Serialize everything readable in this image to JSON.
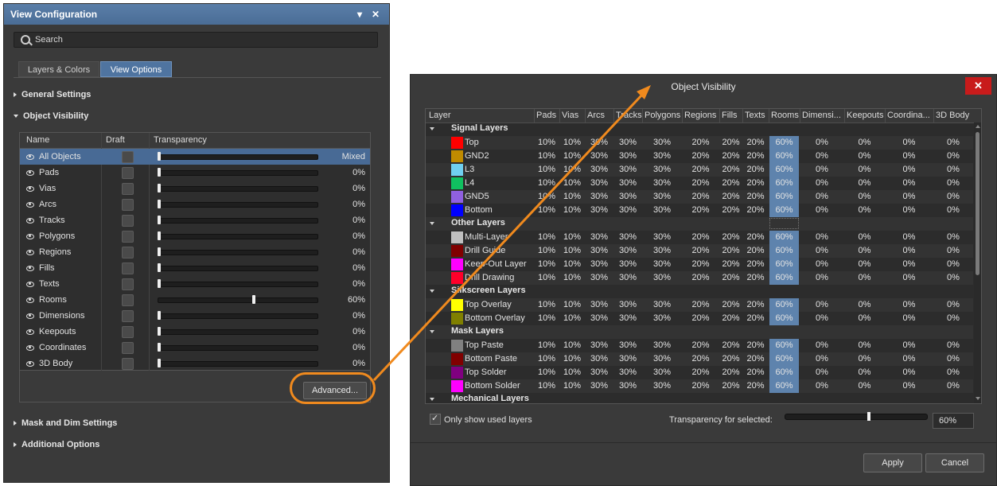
{
  "view_config": {
    "title": "View Configuration",
    "menu_glyph": "▾",
    "close_glyph": "✕",
    "search_placeholder": "Search",
    "tabs": [
      {
        "label": "Layers & Colors"
      },
      {
        "label": "View Options"
      }
    ],
    "active_tab": 1,
    "sections": {
      "general": "General Settings",
      "object_visibility": "Object Visibility",
      "mask_dim": "Mask and Dim Settings",
      "additional": "Additional Options"
    },
    "table_headers": {
      "name": "Name",
      "draft": "Draft",
      "transparency": "Transparency"
    },
    "objects": [
      {
        "name": "All Objects",
        "value": "Mixed",
        "level": 0
      },
      {
        "name": "Pads",
        "value": "0%",
        "level": 0
      },
      {
        "name": "Vias",
        "value": "0%",
        "level": 0
      },
      {
        "name": "Arcs",
        "value": "0%",
        "level": 0
      },
      {
        "name": "Tracks",
        "value": "0%",
        "level": 0
      },
      {
        "name": "Polygons",
        "value": "0%",
        "level": 0
      },
      {
        "name": "Regions",
        "value": "0%",
        "level": 0
      },
      {
        "name": "Fills",
        "value": "0%",
        "level": 0
      },
      {
        "name": "Texts",
        "value": "0%",
        "level": 0
      },
      {
        "name": "Rooms",
        "value": "60%",
        "level": 0.6
      },
      {
        "name": "Dimensions",
        "value": "0%",
        "level": 0
      },
      {
        "name": "Keepouts",
        "value": "0%",
        "level": 0
      },
      {
        "name": "Coordinates",
        "value": "0%",
        "level": 0
      },
      {
        "name": "3D Body",
        "value": "0%",
        "level": 0
      }
    ],
    "advanced_button": "Advanced...",
    "callout_color": "#f08a1e"
  },
  "object_visibility_dialog": {
    "title": "Object Visibility",
    "close_glyph": "✕",
    "columns": [
      "Layer",
      "Pads",
      "Vias",
      "Arcs",
      "Tracks",
      "Polygons",
      "Regions",
      "Fills",
      "Texts",
      "Rooms",
      "Dimensi...",
      "Keepouts",
      "Coordina...",
      "3D Body"
    ],
    "rows": [
      {
        "group": "Signal Layers"
      },
      {
        "layer": "Top",
        "color": "#ff0000",
        "values": [
          "10%",
          "10%",
          "30%",
          "30%",
          "30%",
          "20%",
          "20%",
          "20%",
          "60%",
          "0%",
          "0%",
          "0%",
          "0%"
        ]
      },
      {
        "layer": "GND2",
        "color": "#c08b00",
        "values": [
          "10%",
          "10%",
          "30%",
          "30%",
          "30%",
          "20%",
          "20%",
          "20%",
          "60%",
          "0%",
          "0%",
          "0%",
          "0%"
        ]
      },
      {
        "layer": "L3",
        "color": "#70d0f0",
        "values": [
          "10%",
          "10%",
          "30%",
          "30%",
          "30%",
          "20%",
          "20%",
          "20%",
          "60%",
          "0%",
          "0%",
          "0%",
          "0%"
        ]
      },
      {
        "layer": "L4",
        "color": "#10c060",
        "values": [
          "10%",
          "10%",
          "30%",
          "30%",
          "30%",
          "20%",
          "20%",
          "20%",
          "60%",
          "0%",
          "0%",
          "0%",
          "0%"
        ]
      },
      {
        "layer": "GND5",
        "color": "#9060e0",
        "values": [
          "10%",
          "10%",
          "30%",
          "30%",
          "30%",
          "20%",
          "20%",
          "20%",
          "60%",
          "0%",
          "0%",
          "0%",
          "0%"
        ]
      },
      {
        "layer": "Bottom",
        "color": "#0000ff",
        "values": [
          "10%",
          "10%",
          "30%",
          "30%",
          "30%",
          "20%",
          "20%",
          "20%",
          "60%",
          "0%",
          "0%",
          "0%",
          "0%"
        ]
      },
      {
        "group": "Other Layers"
      },
      {
        "layer": "Multi-Layer",
        "color": "#c0c0c0",
        "values": [
          "10%",
          "10%",
          "30%",
          "30%",
          "30%",
          "20%",
          "20%",
          "20%",
          "60%",
          "0%",
          "0%",
          "0%",
          "0%"
        ]
      },
      {
        "layer": "Drill Guide",
        "color": "#800000",
        "values": [
          "10%",
          "10%",
          "30%",
          "30%",
          "30%",
          "20%",
          "20%",
          "20%",
          "60%",
          "0%",
          "0%",
          "0%",
          "0%"
        ]
      },
      {
        "layer": "Keep-Out Layer",
        "color": "#ff00ff",
        "values": [
          "10%",
          "10%",
          "30%",
          "30%",
          "30%",
          "20%",
          "20%",
          "20%",
          "60%",
          "0%",
          "0%",
          "0%",
          "0%"
        ]
      },
      {
        "layer": "Drill Drawing",
        "color": "#ff002a",
        "values": [
          "10%",
          "10%",
          "30%",
          "30%",
          "30%",
          "20%",
          "20%",
          "20%",
          "60%",
          "0%",
          "0%",
          "0%",
          "0%"
        ]
      },
      {
        "group": "Silkscreen Layers"
      },
      {
        "layer": "Top Overlay",
        "color": "#ffff00",
        "values": [
          "10%",
          "10%",
          "30%",
          "30%",
          "30%",
          "20%",
          "20%",
          "20%",
          "60%",
          "0%",
          "0%",
          "0%",
          "0%"
        ]
      },
      {
        "layer": "Bottom Overlay",
        "color": "#808000",
        "values": [
          "10%",
          "10%",
          "30%",
          "30%",
          "30%",
          "20%",
          "20%",
          "20%",
          "60%",
          "0%",
          "0%",
          "0%",
          "0%"
        ]
      },
      {
        "group": "Mask Layers"
      },
      {
        "layer": "Top Paste",
        "color": "#808080",
        "values": [
          "10%",
          "10%",
          "30%",
          "30%",
          "30%",
          "20%",
          "20%",
          "20%",
          "60%",
          "0%",
          "0%",
          "0%",
          "0%"
        ]
      },
      {
        "layer": "Bottom Paste",
        "color": "#800000",
        "values": [
          "10%",
          "10%",
          "30%",
          "30%",
          "30%",
          "20%",
          "20%",
          "20%",
          "60%",
          "0%",
          "0%",
          "0%",
          "0%"
        ]
      },
      {
        "layer": "Top Solder",
        "color": "#800080",
        "values": [
          "10%",
          "10%",
          "30%",
          "30%",
          "30%",
          "20%",
          "20%",
          "20%",
          "60%",
          "0%",
          "0%",
          "0%",
          "0%"
        ]
      },
      {
        "layer": "Bottom Solder",
        "color": "#ff00ff",
        "values": [
          "10%",
          "10%",
          "30%",
          "30%",
          "30%",
          "20%",
          "20%",
          "20%",
          "60%",
          "0%",
          "0%",
          "0%",
          "0%"
        ]
      },
      {
        "group": "Mechanical Layers"
      }
    ],
    "only_used_label": "Only show used layers",
    "only_used_checked": true,
    "transparency_label": "Transparency for selected:",
    "transparency_value": "60%",
    "transparency_level": 0.6,
    "apply_label": "Apply",
    "cancel_label": "Cancel"
  }
}
